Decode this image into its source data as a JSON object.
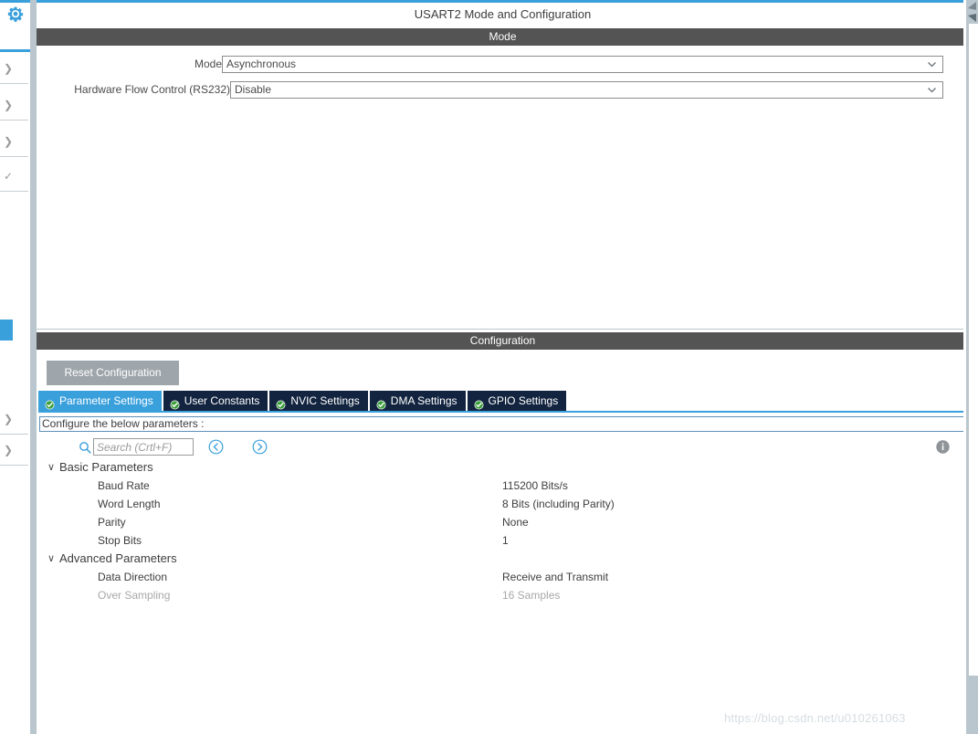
{
  "window": {
    "title": "USART2 Mode and Configuration",
    "accent_color": "#3aa0dc",
    "band_color": "#545454"
  },
  "rail": {
    "gear_icon": "gear-icon",
    "chevron_icon": "chevron-right-icon",
    "check_icon": "check-icon"
  },
  "mode_section": {
    "band_label": "Mode",
    "fields": [
      {
        "label": "Mode",
        "value": "Asynchronous",
        "arrow_icon": "chevron-down-icon"
      },
      {
        "label": "Hardware Flow Control (RS232)",
        "value": "Disable",
        "arrow_icon": "chevron-down-icon"
      }
    ]
  },
  "configuration_section": {
    "band_label": "Configuration",
    "reset_button": "Reset Configuration",
    "tabs": [
      {
        "label": "Parameter Settings",
        "icon": "check-circle-icon",
        "active": true
      },
      {
        "label": "User Constants",
        "icon": "check-circle-icon",
        "active": false
      },
      {
        "label": "NVIC Settings",
        "icon": "check-circle-icon",
        "active": false
      },
      {
        "label": "DMA Settings",
        "icon": "check-circle-icon",
        "active": false
      },
      {
        "label": "GPIO Settings",
        "icon": "check-circle-icon",
        "active": false
      }
    ],
    "configure_hint": "Configure the below parameters :",
    "search": {
      "placeholder": "Search (Crtl+F)",
      "value": "",
      "icon": "search-icon",
      "prev_icon": "arrow-left-circle-icon",
      "next_icon": "arrow-right-circle-icon"
    },
    "info_icon": "info-icon",
    "parameter_groups": [
      {
        "label": "Basic Parameters",
        "expanded": true,
        "twisty": "∨",
        "rows": [
          {
            "name": "Baud Rate",
            "value": "115200 Bits/s",
            "disabled": false
          },
          {
            "name": "Word Length",
            "value": "8 Bits (including Parity)",
            "disabled": false
          },
          {
            "name": "Parity",
            "value": "None",
            "disabled": false
          },
          {
            "name": "Stop Bits",
            "value": "1",
            "disabled": false
          }
        ]
      },
      {
        "label": "Advanced Parameters",
        "expanded": true,
        "twisty": "∨",
        "rows": [
          {
            "name": "Data Direction",
            "value": "Receive and Transmit",
            "disabled": false
          },
          {
            "name": "Over Sampling",
            "value": "16 Samples",
            "disabled": true
          }
        ]
      }
    ]
  },
  "watermark": "https://blog.csdn.net/u010261063",
  "scrollbar": {
    "up_icon": "scroll-up-arrow-icon",
    "down_icon": "scroll-down-arrow-icon"
  }
}
